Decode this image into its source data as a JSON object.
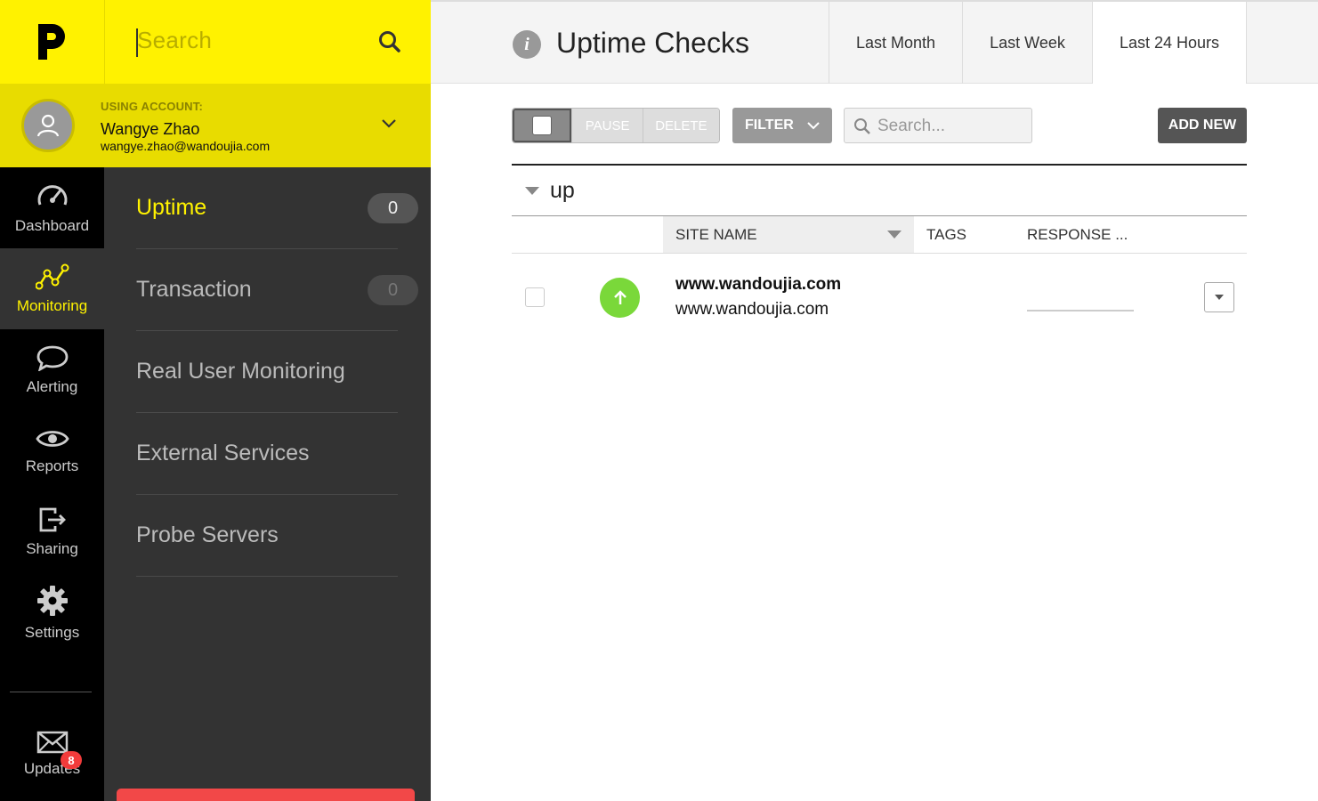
{
  "topbar": {
    "search_placeholder": "Search"
  },
  "account": {
    "label": "USING ACCOUNT:",
    "name": "Wangye Zhao",
    "email": "wangye.zhao@wandoujia.com"
  },
  "rail": {
    "items": [
      {
        "label": "Dashboard",
        "icon": "gauge-icon"
      },
      {
        "label": "Monitoring",
        "icon": "monitoring-graph-icon"
      },
      {
        "label": "Alerting",
        "icon": "speech-bubble-icon"
      },
      {
        "label": "Reports",
        "icon": "eye-icon"
      },
      {
        "label": "Sharing",
        "icon": "share-exit-icon"
      },
      {
        "label": "Settings",
        "icon": "gear-icon"
      }
    ],
    "updates": {
      "label": "Updates",
      "badge": "8",
      "icon": "envelope-icon"
    }
  },
  "subnav": {
    "items": [
      {
        "label": "Uptime",
        "count": "0"
      },
      {
        "label": "Transaction",
        "count": "0"
      },
      {
        "label": "Real User Monitoring"
      },
      {
        "label": "External Services"
      },
      {
        "label": "Probe Servers"
      }
    ]
  },
  "header": {
    "title": "Uptime Checks",
    "tabs": [
      {
        "label": "Last Month"
      },
      {
        "label": "Last Week"
      },
      {
        "label": "Last 24 Hours"
      }
    ]
  },
  "toolbar": {
    "pause": "PAUSE",
    "delete": "DELETE",
    "filter": "FILTER",
    "search_placeholder": "Search...",
    "add_new": "ADD NEW"
  },
  "group": {
    "title": "up"
  },
  "table": {
    "columns": [
      "SITE NAME",
      "TAGS",
      "RESPONSE ..."
    ],
    "rows": [
      {
        "name": "www.wandoujia.com",
        "url": "www.wandoujia.com",
        "status": "up"
      }
    ]
  },
  "colors": {
    "brand_yellow": "#fff200",
    "status_up": "#7ad83a",
    "alert_red": "#f24848"
  }
}
